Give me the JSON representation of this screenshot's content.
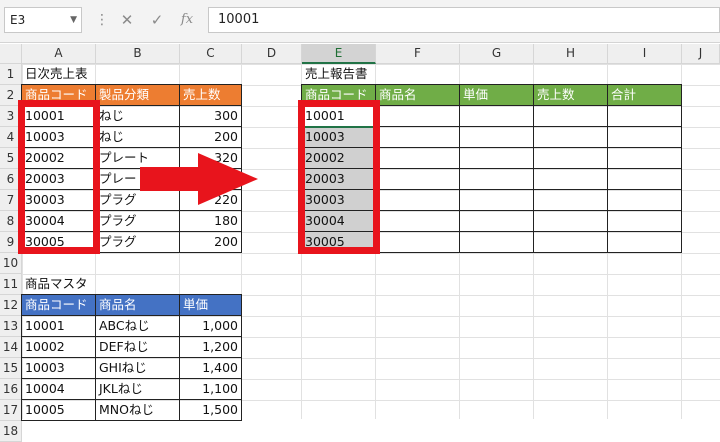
{
  "formula_bar": {
    "name_box": "E3",
    "more_icon": "⋮",
    "cancel_icon": "✕",
    "enter_icon": "✓",
    "fx_icon": "fx",
    "value": "10001"
  },
  "columns": [
    "A",
    "B",
    "C",
    "D",
    "E",
    "F",
    "G",
    "H",
    "I",
    "J"
  ],
  "rows": [
    "1",
    "2",
    "3",
    "4",
    "5",
    "6",
    "7",
    "8",
    "9",
    "10",
    "11",
    "12",
    "13",
    "14",
    "15",
    "16",
    "17",
    "18"
  ],
  "sales_table": {
    "title": "日次売上表",
    "headers": [
      "商品コード",
      "製品分類",
      "売上数"
    ],
    "rows": [
      {
        "code": "10001",
        "category": "ねじ",
        "qty": "300"
      },
      {
        "code": "10003",
        "category": "ねじ",
        "qty": "200"
      },
      {
        "code": "20002",
        "category": "プレート",
        "qty": "320"
      },
      {
        "code": "20003",
        "category": "プレー",
        "qty": ""
      },
      {
        "code": "30003",
        "category": "プラグ",
        "qty": "220"
      },
      {
        "code": "30004",
        "category": "プラグ",
        "qty": "180"
      },
      {
        "code": "30005",
        "category": "プラグ",
        "qty": "200"
      }
    ]
  },
  "report_table": {
    "title": "売上報告書",
    "headers": [
      "商品コード",
      "商品名",
      "単価",
      "売上数",
      "合計"
    ],
    "codes": [
      "10001",
      "10003",
      "20002",
      "20003",
      "30003",
      "30004",
      "30005"
    ]
  },
  "master_table": {
    "title": "商品マスタ",
    "headers": [
      "商品コード",
      "商品名",
      "単価"
    ],
    "rows": [
      {
        "code": "10001",
        "name": "ABCねじ",
        "price": "1,000"
      },
      {
        "code": "10002",
        "name": "DEFねじ",
        "price": "1,200"
      },
      {
        "code": "10003",
        "name": "GHIねじ",
        "price": "1,400"
      },
      {
        "code": "10004",
        "name": "JKLねじ",
        "price": "1,100"
      },
      {
        "code": "10005",
        "name": "MNOねじ",
        "price": "1,500"
      }
    ]
  },
  "colors": {
    "highlight_red": "#e8141c",
    "header_orange": "#ed7d31",
    "header_green": "#70ad47",
    "header_blue": "#4472c4",
    "selection_green": "#217346"
  }
}
